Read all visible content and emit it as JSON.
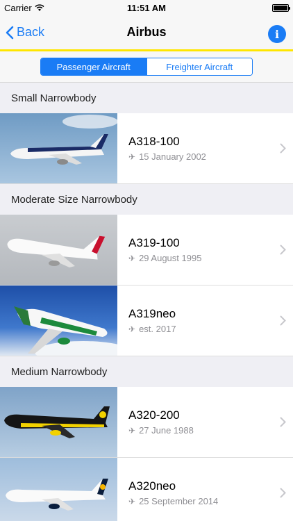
{
  "status": {
    "carrier": "Carrier",
    "time": "11:51 AM"
  },
  "nav": {
    "back_label": "Back",
    "title": "Airbus",
    "info_label": "i"
  },
  "segments": {
    "passenger": "Passenger Aircraft",
    "freighter": "Freighter Aircraft",
    "selected": "Passenger Aircraft"
  },
  "sections": [
    {
      "header": "Small Narrowbody",
      "rows": [
        {
          "name": "A318-100",
          "date": "15 January 2002",
          "sky": "#7fa6c9"
        }
      ]
    },
    {
      "header": "Moderate Size Narrowbody",
      "rows": [
        {
          "name": "A319-100",
          "date": "29 August 1995",
          "sky": "#bfc3c8"
        },
        {
          "name": "A319neo",
          "date": "est. 2017",
          "sky": "#2d62b8"
        }
      ]
    },
    {
      "header": "Medium Narrowbody",
      "rows": [
        {
          "name": "A320-200",
          "date": "27 June 1988",
          "sky": "#9ab8d6"
        },
        {
          "name": "A320neo",
          "date": "25 September 2014",
          "sky": "#a9c3de"
        }
      ]
    }
  ],
  "colors": {
    "accent": "#1a7cf5",
    "nav_underline": "#ffe600"
  }
}
